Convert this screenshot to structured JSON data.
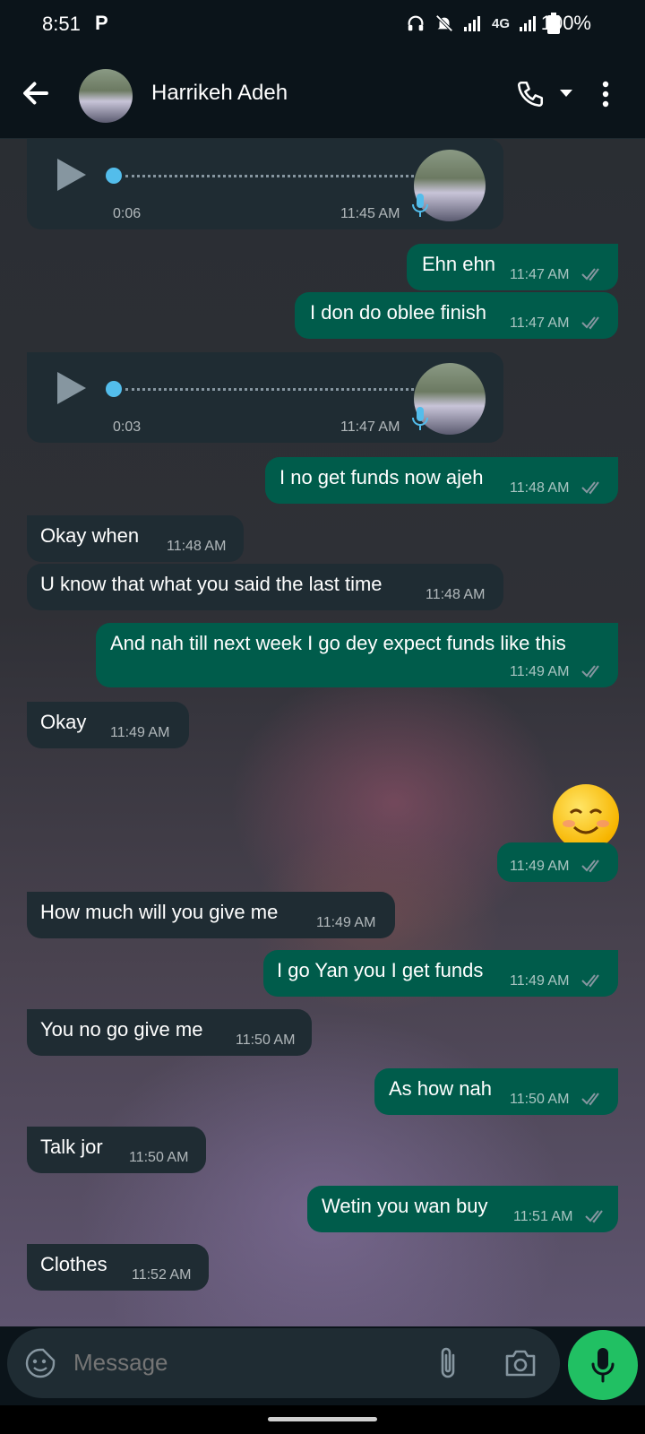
{
  "status_bar": {
    "time": "8:51",
    "carrier_icon": "P",
    "network": "4G",
    "battery": "100%"
  },
  "header": {
    "contact_name": "Harrikeh Adeh"
  },
  "messages": [
    {
      "type": "voice",
      "duration": "0:06",
      "time": "11:45 AM"
    },
    {
      "type": "out",
      "text": "Ehn ehn",
      "time": "11:47 AM"
    },
    {
      "type": "out",
      "text": "I don do oblee finish",
      "time": "11:47 AM"
    },
    {
      "type": "voice",
      "duration": "0:03",
      "time": "11:47 AM"
    },
    {
      "type": "out",
      "text": "I no get funds now ajeh",
      "time": "11:48 AM"
    },
    {
      "type": "in",
      "text": "Okay when",
      "time": "11:48 AM"
    },
    {
      "type": "in",
      "text": "U know that what you said the last time",
      "time": "11:48 AM"
    },
    {
      "type": "out",
      "text": "And nah till next week I go dey expect funds  like this",
      "time": "11:49 AM"
    },
    {
      "type": "in",
      "text": "Okay",
      "time": "11:49 AM"
    },
    {
      "type": "out-emoji",
      "text": "😊",
      "time": "11:49 AM"
    },
    {
      "type": "in",
      "text": "How much will you give me",
      "time": "11:49 AM"
    },
    {
      "type": "out",
      "text": "I go Yan you I get funds",
      "time": "11:49 AM"
    },
    {
      "type": "in",
      "text": "You no go give me",
      "time": "11:50 AM"
    },
    {
      "type": "out",
      "text": "As how nah",
      "time": "11:50 AM"
    },
    {
      "type": "in",
      "text": "Talk jor",
      "time": "11:50 AM"
    },
    {
      "type": "out",
      "text": "Wetin you wan buy",
      "time": "11:51 AM"
    },
    {
      "type": "in",
      "text": "Clothes",
      "time": "11:52 AM"
    }
  ],
  "composer": {
    "placeholder": "Message"
  },
  "colors": {
    "outgoing": "#005c4b",
    "incoming": "#1f2c33",
    "accent": "#21c063",
    "read_ticks": "#8696a0"
  }
}
